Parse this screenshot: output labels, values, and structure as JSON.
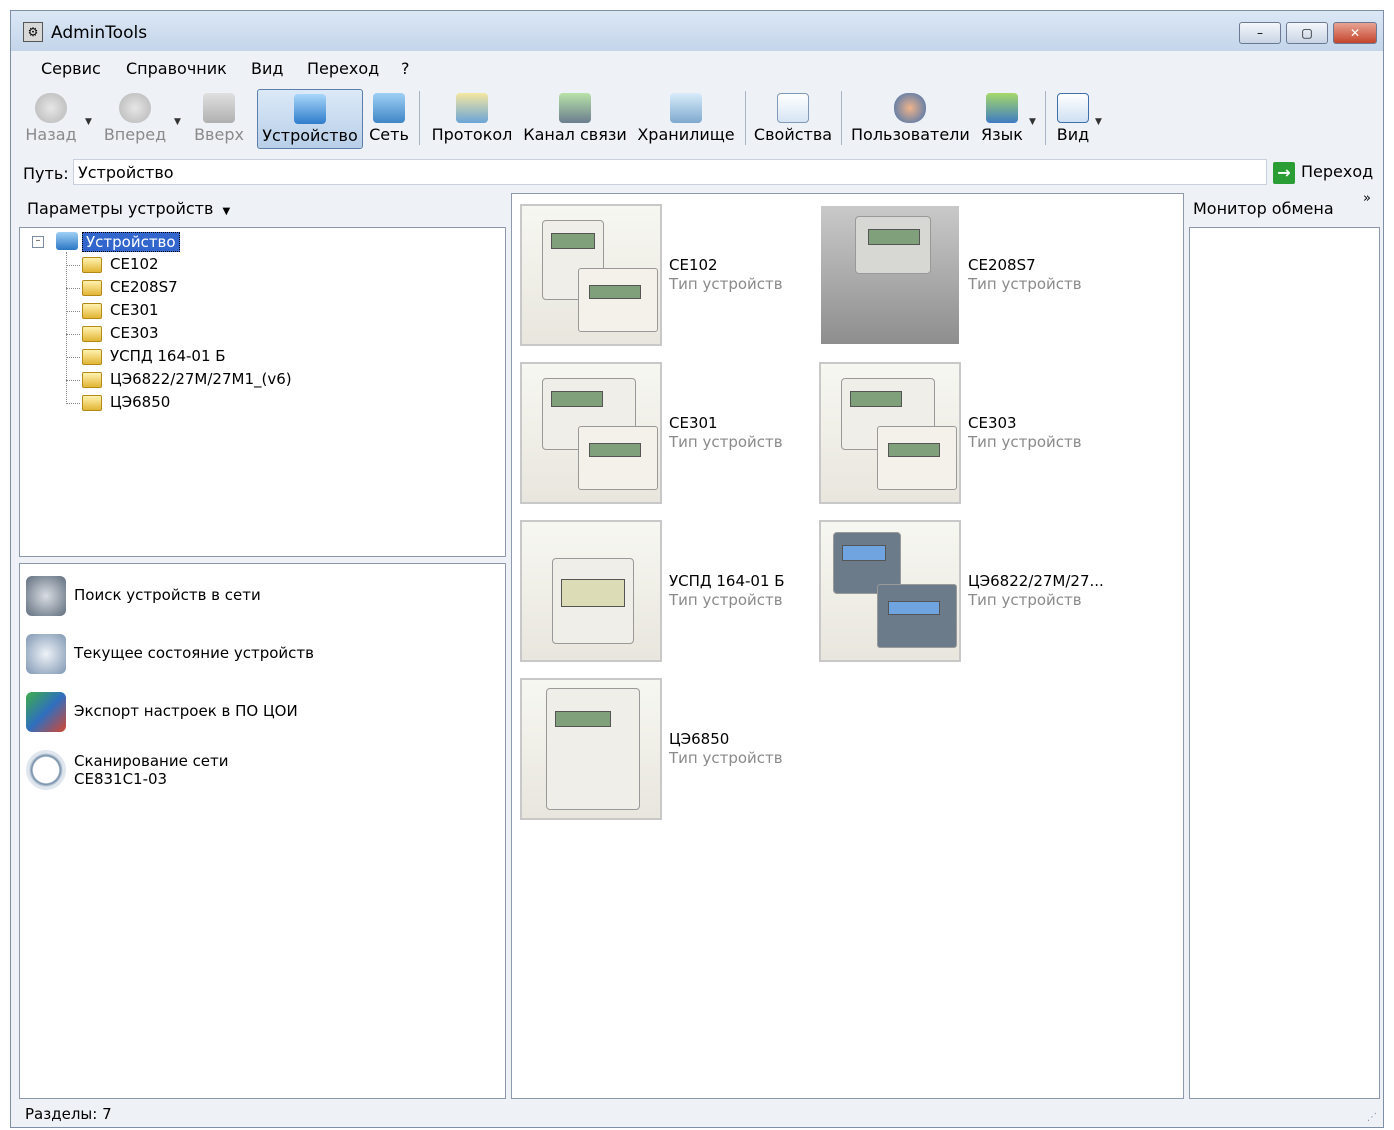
{
  "window": {
    "title": "AdminTools"
  },
  "title_buttons": {
    "minimize": "–",
    "maximize": "▢",
    "close": "✕"
  },
  "menu": [
    "Сервис",
    "Справочник",
    "Вид",
    "Переход",
    "?"
  ],
  "toolbar": {
    "back": "Назад",
    "forward": "Вперед",
    "up": "Вверх",
    "device": "Устройство",
    "network": "Сеть",
    "protocol": "Протокол",
    "channel": "Канал связи",
    "storage": "Хранилище",
    "properties": "Свойства",
    "users": "Пользователи",
    "language": "Язык",
    "view": "Вид"
  },
  "path": {
    "label": "Путь:",
    "value": "Устройство",
    "go_label": "Переход",
    "go_icon": "→"
  },
  "left_panel": {
    "header": "Параметры устройств",
    "tree_root": "Устройство",
    "tree_items": [
      "CE102",
      "CE208S7",
      "CE301",
      "CE303",
      "УСПД 164-01 Б",
      "ЦЭ6822/27М/27М1_(v6)",
      "ЦЭ6850"
    ]
  },
  "tasks": [
    {
      "label": "Поиск устройств в сети",
      "icon": "binoculars-icon"
    },
    {
      "label": "Текущее состояние устройств",
      "icon": "device-status-icon"
    },
    {
      "label": "Экспорт настроек в ПО ЦОИ",
      "icon": "export-icon"
    },
    {
      "label": "Сканирование сети",
      "label2": "CE831C1-03",
      "icon": "magnifier-icon"
    }
  ],
  "devices": [
    {
      "name": "CE102",
      "type": "Тип устройств"
    },
    {
      "name": "CE208S7",
      "type": "Тип устройств"
    },
    {
      "name": "CE301",
      "type": "Тип устройств"
    },
    {
      "name": "CE303",
      "type": "Тип устройств"
    },
    {
      "name": "УСПД 164-01 Б",
      "type": "Тип устройств"
    },
    {
      "name": "ЦЭ6822/27М/27...",
      "type": "Тип устройств"
    },
    {
      "name": "ЦЭ6850",
      "type": "Тип устройств"
    }
  ],
  "monitor": {
    "header": "Монитор обмена",
    "expand": "»"
  },
  "status": {
    "text": "Разделы: 7"
  },
  "colors": {
    "selection": "#3366cc",
    "muted_text": "#8a8a8a",
    "window_bg": "#eef1f6"
  }
}
